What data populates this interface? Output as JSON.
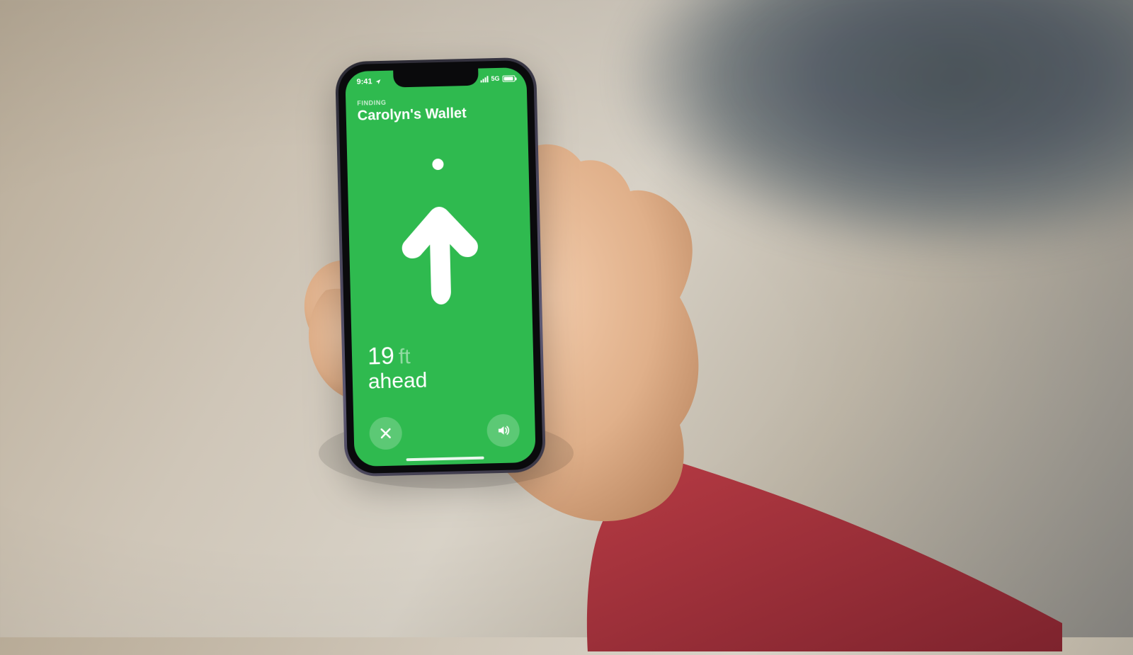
{
  "status": {
    "time": "9:41",
    "network": "5G"
  },
  "header": {
    "eyebrow": "FINDING",
    "title": "Carolyn's Wallet"
  },
  "distance": {
    "value": "19",
    "unit": "ft",
    "direction": "ahead"
  },
  "buttons": {
    "close": "Close",
    "sound": "Play Sound"
  },
  "colors": {
    "screen": "#2fba4f",
    "muted": "rgba(255,255,255,.48)"
  }
}
